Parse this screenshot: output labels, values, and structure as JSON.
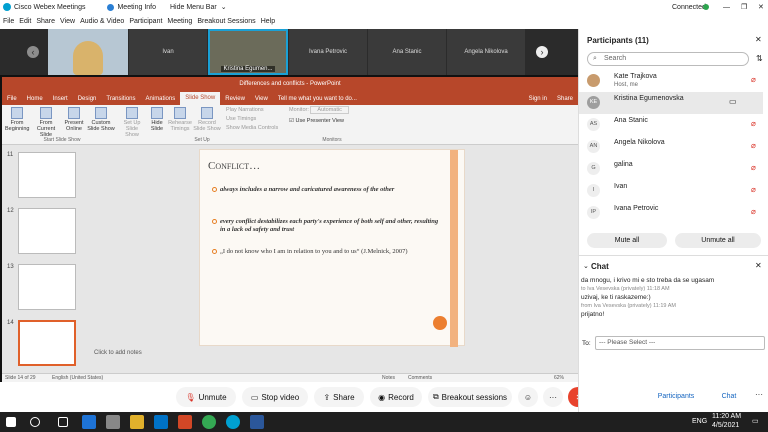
{
  "window": {
    "title": "Cisco Webex Meetings",
    "meeting_info": "Meeting Info",
    "hide_menu": "Hide Menu Bar",
    "status": "Connected"
  },
  "menu": [
    "File",
    "Edit",
    "Share",
    "View",
    "Audio & Video",
    "Participant",
    "Meeting",
    "Breakout Sessions",
    "Help"
  ],
  "videos": [
    {
      "name": "Ivan"
    },
    {
      "name": "Kristina Egumen..."
    },
    {
      "name": "Ivana Petrovic"
    },
    {
      "name": "Ana Stanic"
    },
    {
      "name": "Angela Nikolova"
    }
  ],
  "ppt": {
    "doc_title": "Differences and conflicts - PowerPoint",
    "tabs": [
      "File",
      "Home",
      "Insert",
      "Design",
      "Transitions",
      "Animations",
      "Slide Show",
      "Review",
      "View",
      "Tell me what you want to do...",
      "Sign in",
      "Share"
    ],
    "ribbon": {
      "from_beginning": "From Beginning",
      "from_current": "From Current Slide",
      "present_online": "Present Online",
      "custom": "Custom Slide Show",
      "setup": "Set Up Slide Show",
      "hide": "Hide Slide",
      "rehearse": "Rehearse Timings",
      "record": "Record Slide Show",
      "play_narrations": "Play Narrations",
      "use_timings": "Use Timings",
      "show_media": "Show Media Controls",
      "monitor": "Monitor:",
      "automatic": "Automatic",
      "presenter_view": "Use Presenter View",
      "group_start": "Start Slide Show",
      "group_setup": "Set Up",
      "group_monitors": "Monitors"
    },
    "thumb_numbers": [
      "11",
      "12",
      "13",
      "14"
    ],
    "slide": {
      "title": "Conflict…",
      "bullets": [
        "always includes a narrow and caricatured awareness of the other",
        "every conflict destabilizes each party's experience of both self and other, resulting in a lack od safety and trust",
        "„I do not know who I am in relation to you and to us“ (J.Melnick, 2007)"
      ]
    },
    "notes": "Click to add notes",
    "status": {
      "slide": "Slide 14 of 29",
      "lang": "English (United States)",
      "notes": "Notes",
      "comments": "Comments",
      "zoom": "62%"
    }
  },
  "controls": {
    "unmute": "Unmute",
    "stop_video": "Stop video",
    "share": "Share",
    "record": "Record",
    "breakout": "Breakout sessions",
    "participants": "Participants",
    "chat": "Chat"
  },
  "participants": {
    "header": "Participants (11)",
    "search": "Search",
    "list": [
      {
        "initials": "",
        "name": "Kate Trajkova",
        "sub": "Host, me",
        "muted": true
      },
      {
        "initials": "KE",
        "name": "Kristina Egumenovska",
        "sub": "",
        "muted": false
      },
      {
        "initials": "AS",
        "name": "Ana Stanic",
        "sub": "",
        "muted": true
      },
      {
        "initials": "AN",
        "name": "Angela Nikolova",
        "sub": "",
        "muted": true
      },
      {
        "initials": "G",
        "name": "galina",
        "sub": "",
        "muted": true
      },
      {
        "initials": "I",
        "name": "Ivan",
        "sub": "",
        "muted": true
      },
      {
        "initials": "IP",
        "name": "Ivana Petrovic",
        "sub": "",
        "muted": true
      }
    ],
    "mute_all": "Mute all",
    "unmute_all": "Unmute all"
  },
  "chat": {
    "header": "Chat",
    "messages": [
      {
        "text": "da mnogu, i krivo mi e sto treba da se ugasam",
        "meta": ""
      },
      {
        "text": "",
        "meta": "to Iva Vesevska (privately)    11:18 AM"
      },
      {
        "text": "uzivaj, ke ti raskazeme:)",
        "meta": ""
      },
      {
        "text": "",
        "meta": "from Iva Vesevska (privately)    11:19 AM"
      },
      {
        "text": "prijatno!",
        "meta": ""
      }
    ],
    "to_label": "To:",
    "select": "--- Please Select ---"
  },
  "taskbar": {
    "time": "11:20 AM",
    "date": "4/5/2021",
    "lang": "ENG"
  },
  "colors": {
    "ppt_accent": "#b7472a",
    "webex_red": "#e8432d",
    "mute_red": "#d93025"
  }
}
